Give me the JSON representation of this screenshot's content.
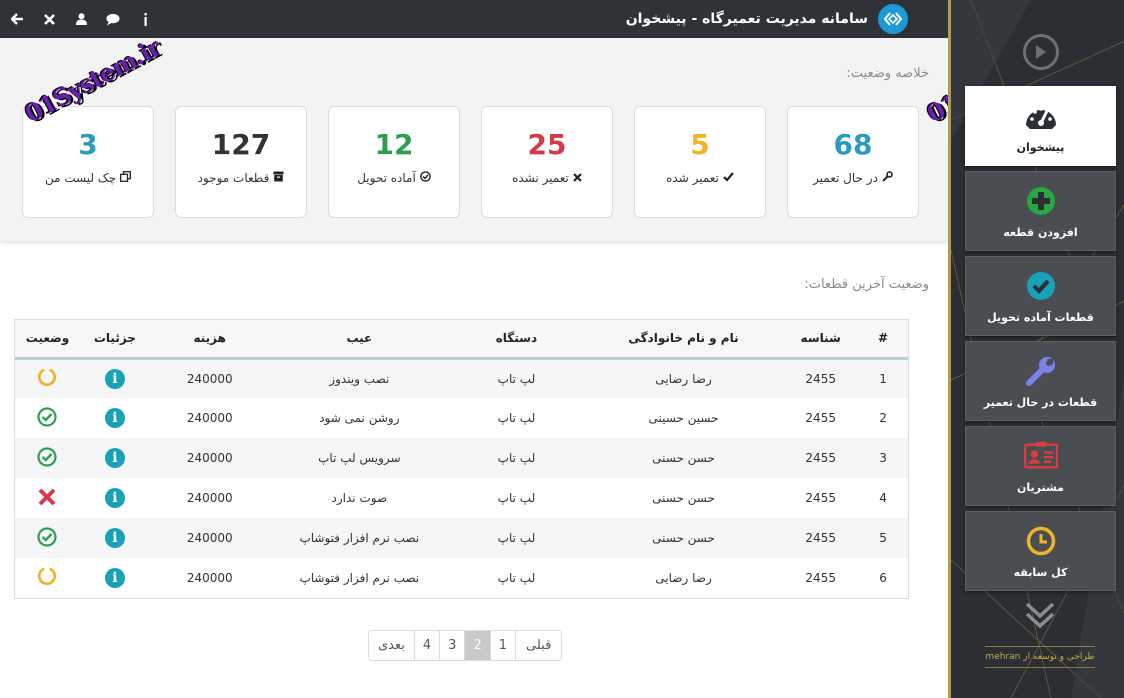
{
  "header": {
    "title": "سامانه مدیریت تعمیرگاه - پیشخوان",
    "icons": [
      "arrow-left-icon",
      "close-icon",
      "user-icon",
      "comment-icon",
      "info-icon"
    ]
  },
  "watermark": "01System.ir",
  "summary": {
    "title": "خلاصه وضعیت:",
    "cards": [
      {
        "value": "68",
        "label": "در حال تعمیر",
        "icon": "wrench-icon",
        "color": "#2b9cc0"
      },
      {
        "value": "5",
        "label": "تعمیر شده",
        "icon": "check-icon",
        "color": "#f0b429"
      },
      {
        "value": "25",
        "label": "تعمیر نشده",
        "icon": "close-icon",
        "color": "#d33a4a"
      },
      {
        "value": "12",
        "label": "آماده تحویل",
        "icon": "check-circle-icon",
        "color": "#2e9e4f"
      },
      {
        "value": "127",
        "label": "قطعات موجود",
        "icon": "archive-icon",
        "color": "#333333"
      },
      {
        "value": "3",
        "label": "چک لیست من",
        "icon": "copy-icon",
        "color": "#2b9cc0"
      }
    ]
  },
  "parts": {
    "title": "وضعیت آخرین قطعات:",
    "columns": [
      "#",
      "شناسه",
      "نام و نام خانوادگی",
      "دستگاه",
      "عیب",
      "هزینه",
      "جزئیات",
      "وضعیت"
    ],
    "rows": [
      {
        "num": "1",
        "id": "2455",
        "name": "رضا رضایی",
        "device": "لپ تاپ",
        "fault": "نصب ویندوز",
        "cost": "240000",
        "status": "pending"
      },
      {
        "num": "2",
        "id": "2455",
        "name": "حسین حسینی",
        "device": "لپ تاپ",
        "fault": "روشن نمی شود",
        "cost": "240000",
        "status": "done"
      },
      {
        "num": "3",
        "id": "2455",
        "name": "حسن حسنی",
        "device": "لپ تاپ",
        "fault": "سرویس لپ تاپ",
        "cost": "240000",
        "status": "done"
      },
      {
        "num": "4",
        "id": "2455",
        "name": "حسن حسنی",
        "device": "لپ تاپ",
        "fault": "صوت ندارد",
        "cost": "240000",
        "status": "failed"
      },
      {
        "num": "5",
        "id": "2455",
        "name": "حسن حسنی",
        "device": "لپ تاپ",
        "fault": "نصب نرم افزار فتوشاپ",
        "cost": "240000",
        "status": "done"
      },
      {
        "num": "6",
        "id": "2455",
        "name": "رضا رضایی",
        "device": "لپ تاپ",
        "fault": "نصب نرم افزار فتوشاپ",
        "cost": "240000",
        "status": "pending"
      }
    ],
    "status_colors": {
      "pending": "#f0b429",
      "done": "#2e9e4f",
      "failed": "#d33a4a"
    }
  },
  "pagination": {
    "prev": "قبلی",
    "pages": [
      "1",
      "2",
      "3",
      "4"
    ],
    "active": "2",
    "next": "بعدی"
  },
  "sidebar": {
    "items": [
      {
        "label": "پیشخوان",
        "icon": "dashboard-gauge-icon",
        "active": true
      },
      {
        "label": "افزودن قطعه",
        "icon": "plus-circle-icon",
        "active": false
      },
      {
        "label": "قطعات آماده تحویل",
        "icon": "check-circle-icon",
        "active": false
      },
      {
        "label": "قطعات در حال تعمیر",
        "icon": "wrench-icon",
        "active": false
      },
      {
        "label": "مشتریان",
        "icon": "id-card-icon",
        "active": false
      },
      {
        "label": "کل سابقه",
        "icon": "clock-icon",
        "active": false
      }
    ],
    "credit": "طراحی و توسعه از mehran"
  },
  "colors": {
    "accent": "#1d9ad6",
    "topbar": "#2f3237",
    "sidebar_border": "#b59a4c"
  }
}
